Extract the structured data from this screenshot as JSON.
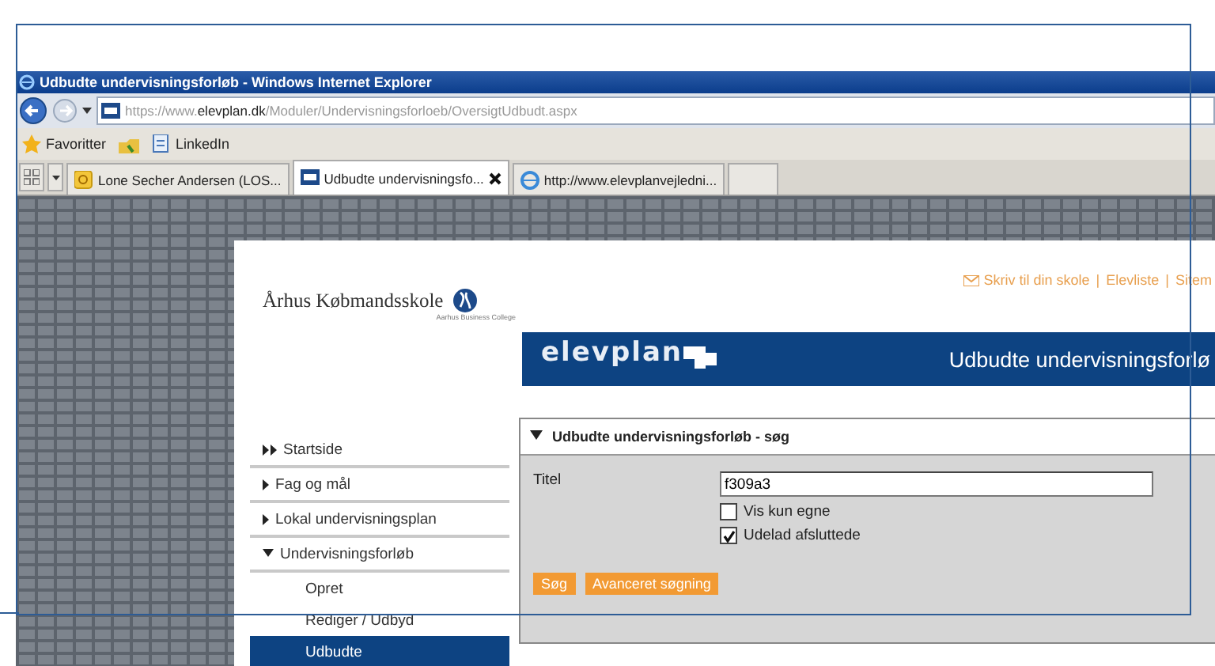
{
  "window": {
    "title": "Udbudte undervisningsforløb - Windows Internet Explorer"
  },
  "address_bar": {
    "url_prefix": "https://www.",
    "url_domain": "elevplan.dk",
    "url_path": "/Moduler/Undervisningsforloeb/OversigtUdbudt.aspx"
  },
  "favorites_bar": {
    "items": [
      {
        "label": "Favoritter",
        "kind": "star"
      },
      {
        "label": "LinkedIn",
        "kind": "page"
      }
    ]
  },
  "tabs": [
    {
      "label": "Lone Secher Andersen (LOS...",
      "selected": false,
      "kind": "mail"
    },
    {
      "label": "Udbudte undervisningsfo...",
      "selected": true,
      "kind": "site"
    },
    {
      "label": "http://www.elevplanvejledni...",
      "selected": false,
      "kind": "ie"
    }
  ],
  "site": {
    "top_links": [
      "Skriv til din skole",
      "Elevliste",
      "Sitem"
    ],
    "separator": "|",
    "school_name": "Århus Købmandsskole",
    "school_subtitle": "Aarhus Business College",
    "brand": "elevplan",
    "banner_title": "Udbudte undervisningsforlø"
  },
  "sidebar": {
    "items": [
      {
        "label": "Startside",
        "kind": "home",
        "selected": false
      },
      {
        "label": "Fag og mål",
        "kind": "section",
        "expanded": false,
        "selected": false
      },
      {
        "label": "Lokal undervisningsplan",
        "kind": "section",
        "expanded": false,
        "selected": false
      },
      {
        "label": "Undervisningsforløb",
        "kind": "section",
        "expanded": true,
        "selected": false,
        "children": [
          {
            "label": "Opret",
            "selected": false
          },
          {
            "label": "Rediger / Udbyd",
            "selected": false
          },
          {
            "label": "Udbudte",
            "selected": true
          }
        ]
      }
    ]
  },
  "search_panel": {
    "title": "Udbudte undervisningsforløb - søg",
    "expanded": true,
    "field": {
      "label": "Titel",
      "value": "f309a3"
    },
    "checkboxes": [
      {
        "label": "Vis kun egne",
        "checked": false
      },
      {
        "label": "Udelad afsluttede",
        "checked": true
      }
    ],
    "buttons": [
      "Søg",
      "Avanceret søgning"
    ]
  }
}
